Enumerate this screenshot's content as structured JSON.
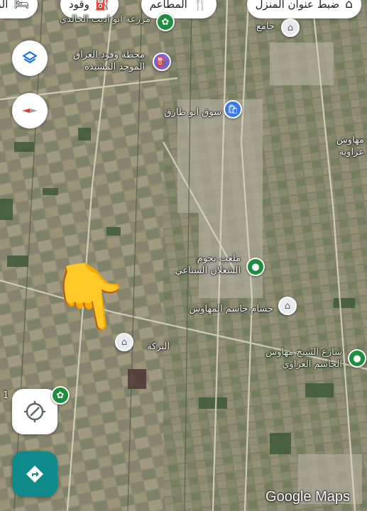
{
  "top_chips": [
    {
      "label": "ضبط عنوان المنزل",
      "icon": "home-icon"
    },
    {
      "label": "المطاعم",
      "icon": "restaurant-icon"
    },
    {
      "label": "وقود",
      "icon": "gas-station-icon"
    },
    {
      "label": "الق",
      "icon": "hotel-icon"
    }
  ],
  "places": {
    "farm": "مزرعة ابو اديب الخالدي",
    "mosque_top": "جامع",
    "fuel_station_line1": "محطة وقود العراق",
    "fuel_station_line2": "الموحد المشيدة",
    "market": "سوق ابو طارق",
    "mahawish_line1": "مهاوش",
    "mahawish_line2": "عزاوية",
    "stadium_line1": "ملعب نجوم",
    "stadium_line2": "الشعلان السباعي",
    "husam": "حسام جاسم المهاوش",
    "barka": "البركة",
    "street_line1": "شارع الشيخ مهاوش",
    "street_line2": "الجاسم العزاوي",
    "left_edge": "1"
  },
  "overlay": {
    "pointing_hand": "👇"
  },
  "watermark": "Google Maps",
  "colors": {
    "accent_teal": "#0f8a8a",
    "pin_green": "#1e8e3e",
    "pin_blue": "#3b78e7"
  }
}
